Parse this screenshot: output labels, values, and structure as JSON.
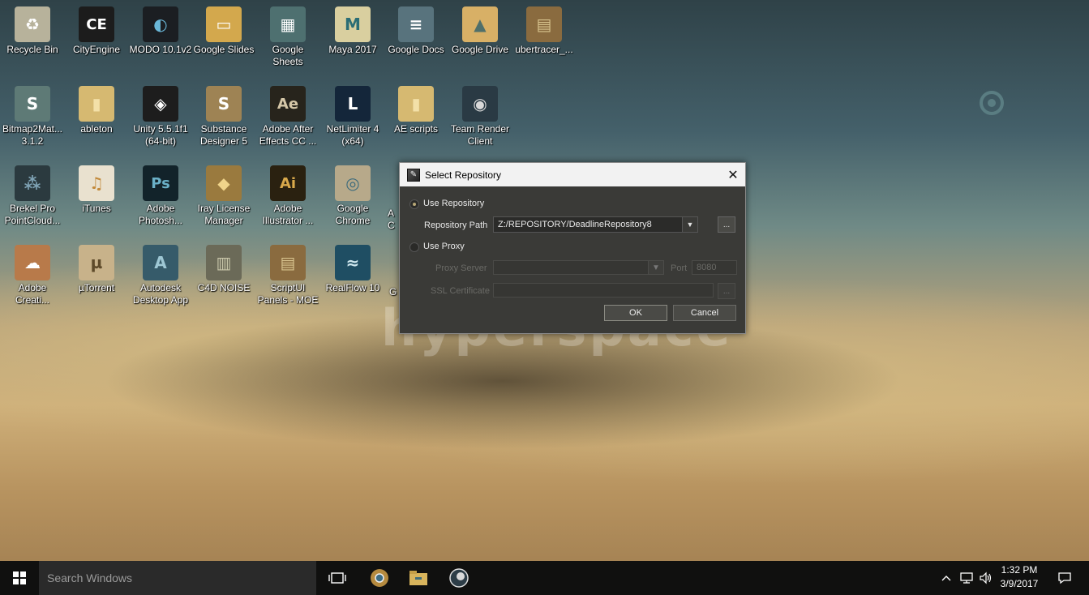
{
  "desktop": {
    "icons": [
      {
        "label": "Recycle Bin",
        "glyph": "♻",
        "icon": "recycle-bin-icon",
        "bg": "#b7b29b",
        "fg": "#fff"
      },
      {
        "label": "CityEngine",
        "glyph": "CE",
        "icon": "cityengine-icon",
        "bg": "#1c1c1c",
        "fg": "#fff"
      },
      {
        "label": "MODO 10.1v2",
        "glyph": "◐",
        "icon": "modo-icon",
        "bg": "#1b1e22",
        "fg": "#6ab7d8"
      },
      {
        "label": "Google Slides",
        "glyph": "▭",
        "icon": "google-slides-icon",
        "bg": "#d3a84d",
        "fg": "#fff"
      },
      {
        "label": "Google Sheets",
        "glyph": "▦",
        "icon": "google-sheets-icon",
        "bg": "#4e7070",
        "fg": "#fff"
      },
      {
        "label": "Maya 2017",
        "glyph": "M",
        "icon": "maya-icon",
        "bg": "#d9cf9f",
        "fg": "#2b6d75"
      },
      {
        "label": "Google Docs",
        "glyph": "≡",
        "icon": "google-docs-icon",
        "bg": "#58737d",
        "fg": "#fff"
      },
      {
        "label": "Google Drive",
        "glyph": "▲",
        "icon": "google-drive-icon",
        "bg": "#d8b066",
        "fg": "#4f6f6a"
      },
      {
        "label": "ubertracer_...",
        "glyph": "▤",
        "icon": "winrar-archive-icon",
        "bg": "#8a6b3f",
        "fg": "#d8c48e"
      },
      {
        "label": "Bitmap2Mat...\n3.1.2",
        "glyph": "S",
        "icon": "bitmap2material-icon",
        "bg": "#5e7a76",
        "fg": "#fff"
      },
      {
        "label": "ableton",
        "glyph": "▮",
        "icon": "folder-icon",
        "bg": "#d6b971",
        "fg": "#f3e0a8"
      },
      {
        "label": "Unity 5.5.1f1\n(64-bit)",
        "glyph": "◈",
        "icon": "unity-icon",
        "bg": "#1d1d1d",
        "fg": "#fff"
      },
      {
        "label": "Substance\nDesigner 5",
        "glyph": "S",
        "icon": "substance-designer-icon",
        "bg": "#9e8354",
        "fg": "#fff"
      },
      {
        "label": "Adobe After\nEffects CC ...",
        "glyph": "Ae",
        "icon": "after-effects-icon",
        "bg": "#27241c",
        "fg": "#d5c7a8"
      },
      {
        "label": "NetLimiter 4\n(x64)",
        "glyph": "L",
        "icon": "netlimiter-icon",
        "bg": "#14263a",
        "fg": "#fff"
      },
      {
        "label": "AE scripts",
        "glyph": "▮",
        "icon": "folder-icon",
        "bg": "#d6b971",
        "fg": "#f3e0a8"
      },
      {
        "label": "Team Render\nClient",
        "glyph": "◉",
        "icon": "team-render-icon",
        "bg": "#2a3a44",
        "fg": "#d9d9d9"
      },
      {
        "label": "Brekel Pro\nPointCloud...",
        "glyph": "⁂",
        "icon": "brekel-icon",
        "bg": "#2b3a3f",
        "fg": "#7fa3b5"
      },
      {
        "label": "iTunes",
        "glyph": "♫",
        "icon": "itunes-icon",
        "bg": "#e9e1cf",
        "fg": "#c2893a"
      },
      {
        "label": "Adobe\nPhotosh...",
        "glyph": "Ps",
        "icon": "photoshop-icon",
        "bg": "#12232a",
        "fg": "#6ab0c7"
      },
      {
        "label": "Iray License\nManager",
        "glyph": "◆",
        "icon": "iray-icon",
        "bg": "#9a7a3e",
        "fg": "#f0d48a"
      },
      {
        "label": "Adobe\nIllustrator ...",
        "glyph": "Ai",
        "icon": "illustrator-icon",
        "bg": "#2a2110",
        "fg": "#d9a94b"
      },
      {
        "label": "Google\nChrome",
        "glyph": "◎",
        "icon": "chrome-icon",
        "bg": "#b7a98a",
        "fg": "#3d6b7c"
      },
      {
        "label": "Adobe\nCreati...",
        "glyph": "☁",
        "icon": "creative-cloud-icon",
        "bg": "#b87a4a",
        "fg": "#fff"
      },
      {
        "label": "µTorrent",
        "glyph": "µ",
        "icon": "utorrent-icon",
        "bg": "#c8b28a",
        "fg": "#5e4a2a"
      },
      {
        "label": "Autodesk\nDesktop App",
        "glyph": "A",
        "icon": "autodesk-icon",
        "bg": "#365b6a",
        "fg": "#9ec7d4"
      },
      {
        "label": "C4D NOISE",
        "glyph": "▥",
        "icon": "c4d-noise-icon",
        "bg": "#6b6a58",
        "fg": "#c9c7aa"
      },
      {
        "label": "ScriptUI\nPanels - MOE",
        "glyph": "▤",
        "icon": "winrar-archive-icon",
        "bg": "#8a6b3f",
        "fg": "#d8c48e"
      },
      {
        "label": "RealFlow 10",
        "glyph": "≈",
        "icon": "realflow-icon",
        "bg": "#1f4e63",
        "fg": "#cfe7ee"
      }
    ],
    "partial_labels": [
      "A",
      "C",
      "G"
    ],
    "background_text": "hyperspace"
  },
  "dialog": {
    "title": "Select Repository",
    "close_glyph": "✕",
    "use_repository_label": "Use Repository",
    "repository_path_label": "Repository Path",
    "repository_path_value": "Z:/REPOSITORY/DeadlineRepository8",
    "browse_label": "...",
    "use_proxy_label": "Use Proxy",
    "proxy_server_label": "Proxy Server",
    "port_label": "Port",
    "port_value": "8080",
    "ssl_certificate_label": "SSL Certificate",
    "ok_label": "OK",
    "cancel_label": "Cancel",
    "use_repository_selected": true,
    "use_proxy_selected": false
  },
  "taskbar": {
    "search_placeholder": "Search Windows",
    "time": "1:32 PM",
    "date": "3/9/2017",
    "pinned": [
      "task-view-icon",
      "chrome-icon",
      "file-explorer-icon",
      "cinema4d-icon"
    ],
    "tray": [
      "chevron-up-icon",
      "network-icon",
      "volume-icon",
      "notification-icon"
    ]
  },
  "colors": {
    "taskbar": "#10100f",
    "dialog_bg": "#3a3a37",
    "accent": "#b8a877"
  }
}
